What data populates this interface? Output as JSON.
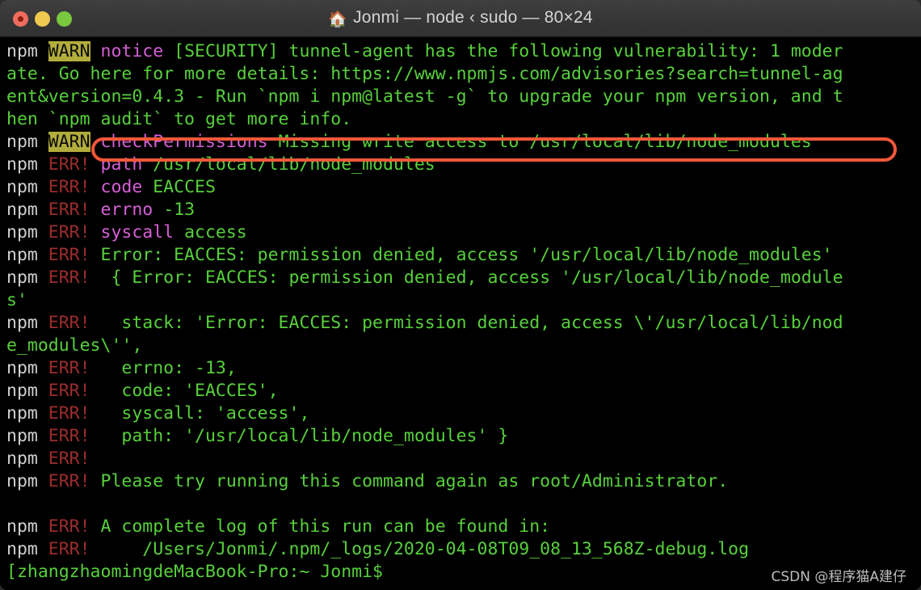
{
  "window": {
    "title": "Jonmi — node ‹ sudo — 80×24",
    "home_icon": "🏠",
    "cols": 80,
    "rows": 24,
    "controls": {
      "close_label": "",
      "minimize_label": "",
      "maximize_label": ""
    }
  },
  "colors": {
    "background": "#000000",
    "green": "#57d13b",
    "npm_white": "#d0d0d0",
    "err_red": "#9e2d2d",
    "warn_bg": "#b2ad3c",
    "warn_fg": "#0a0a0a",
    "magenta": "#d75fd7",
    "annotation": "#f4573a",
    "titlebar": "#363637"
  },
  "annotation": {
    "shape": "rounded-rectangle",
    "color": "#f4573a",
    "target_line_index": 4,
    "text": "checkPermissions Missing write access to /usr/local/lib/node_modules"
  },
  "watermark": {
    "text": "CSDN @程序猫A建仔"
  },
  "terminal": {
    "lines": [
      {
        "segs": [
          {
            "t": "npm ",
            "c": "c-npm"
          },
          {
            "t": "WARN",
            "c": "c-warn"
          },
          {
            "t": " ",
            "c": "c-green"
          },
          {
            "t": "notice",
            "c": "c-key"
          },
          {
            "t": " [SECURITY] tunnel-agent has the following vulnerability: 1 moder",
            "c": "c-green"
          }
        ]
      },
      {
        "segs": [
          {
            "t": "ate. Go here for more details: https://www.npmjs.com/advisories?search=tunnel-ag",
            "c": "c-green"
          }
        ]
      },
      {
        "segs": [
          {
            "t": "ent&version=0.4.3 - Run `npm i npm@latest -g` to upgrade your npm version, and t",
            "c": "c-green"
          }
        ]
      },
      {
        "segs": [
          {
            "t": "hen `npm audit` to get more info.",
            "c": "c-green"
          }
        ]
      },
      {
        "segs": [
          {
            "t": "npm ",
            "c": "c-npm"
          },
          {
            "t": "WARN",
            "c": "c-warn"
          },
          {
            "t": " ",
            "c": "c-green"
          },
          {
            "t": "checkPermissions",
            "c": "c-key"
          },
          {
            "t": " Missing write access to /usr/local/lib/node_modules",
            "c": "c-green"
          }
        ]
      },
      {
        "segs": [
          {
            "t": "npm ",
            "c": "c-npm"
          },
          {
            "t": "ERR!",
            "c": "c-err"
          },
          {
            "t": " ",
            "c": "c-green"
          },
          {
            "t": "path",
            "c": "c-key"
          },
          {
            "t": " /usr/local/lib/node_modules",
            "c": "c-green"
          }
        ]
      },
      {
        "segs": [
          {
            "t": "npm ",
            "c": "c-npm"
          },
          {
            "t": "ERR!",
            "c": "c-err"
          },
          {
            "t": " ",
            "c": "c-green"
          },
          {
            "t": "code",
            "c": "c-key"
          },
          {
            "t": " EACCES",
            "c": "c-green"
          }
        ]
      },
      {
        "segs": [
          {
            "t": "npm ",
            "c": "c-npm"
          },
          {
            "t": "ERR!",
            "c": "c-err"
          },
          {
            "t": " ",
            "c": "c-green"
          },
          {
            "t": "errno",
            "c": "c-key"
          },
          {
            "t": " -13",
            "c": "c-green"
          }
        ]
      },
      {
        "segs": [
          {
            "t": "npm ",
            "c": "c-npm"
          },
          {
            "t": "ERR!",
            "c": "c-err"
          },
          {
            "t": " ",
            "c": "c-green"
          },
          {
            "t": "syscall",
            "c": "c-key"
          },
          {
            "t": " access",
            "c": "c-green"
          }
        ]
      },
      {
        "segs": [
          {
            "t": "npm ",
            "c": "c-npm"
          },
          {
            "t": "ERR!",
            "c": "c-err"
          },
          {
            "t": " Error: EACCES: permission denied, access '/usr/local/lib/node_modules'",
            "c": "c-green"
          }
        ]
      },
      {
        "segs": [
          {
            "t": "npm ",
            "c": "c-npm"
          },
          {
            "t": "ERR!",
            "c": "c-err"
          },
          {
            "t": "  { Error: EACCES: permission denied, access '/usr/local/lib/node_module",
            "c": "c-green"
          }
        ]
      },
      {
        "segs": [
          {
            "t": "s'",
            "c": "c-green"
          }
        ]
      },
      {
        "segs": [
          {
            "t": "npm ",
            "c": "c-npm"
          },
          {
            "t": "ERR!",
            "c": "c-err"
          },
          {
            "t": "   stack: 'Error: EACCES: permission denied, access \\'/usr/local/lib/nod",
            "c": "c-green"
          }
        ]
      },
      {
        "segs": [
          {
            "t": "e_modules\\'',",
            "c": "c-green"
          }
        ]
      },
      {
        "segs": [
          {
            "t": "npm ",
            "c": "c-npm"
          },
          {
            "t": "ERR!",
            "c": "c-err"
          },
          {
            "t": "   errno: -13,",
            "c": "c-green"
          }
        ]
      },
      {
        "segs": [
          {
            "t": "npm ",
            "c": "c-npm"
          },
          {
            "t": "ERR!",
            "c": "c-err"
          },
          {
            "t": "   code: 'EACCES',",
            "c": "c-green"
          }
        ]
      },
      {
        "segs": [
          {
            "t": "npm ",
            "c": "c-npm"
          },
          {
            "t": "ERR!",
            "c": "c-err"
          },
          {
            "t": "   syscall: 'access',",
            "c": "c-green"
          }
        ]
      },
      {
        "segs": [
          {
            "t": "npm ",
            "c": "c-npm"
          },
          {
            "t": "ERR!",
            "c": "c-err"
          },
          {
            "t": "   path: '/usr/local/lib/node_modules' }",
            "c": "c-green"
          }
        ]
      },
      {
        "segs": [
          {
            "t": "npm ",
            "c": "c-npm"
          },
          {
            "t": "ERR!",
            "c": "c-err"
          }
        ]
      },
      {
        "segs": [
          {
            "t": "npm ",
            "c": "c-npm"
          },
          {
            "t": "ERR!",
            "c": "c-err"
          },
          {
            "t": " Please try running this command again as root/Administrator.",
            "c": "c-green"
          }
        ]
      },
      {
        "segs": [
          {
            "t": " ",
            "c": "c-green"
          }
        ]
      },
      {
        "segs": [
          {
            "t": "npm ",
            "c": "c-npm"
          },
          {
            "t": "ERR!",
            "c": "c-err"
          },
          {
            "t": " A complete log of this run can be found in:",
            "c": "c-green"
          }
        ]
      },
      {
        "segs": [
          {
            "t": "npm ",
            "c": "c-npm"
          },
          {
            "t": "ERR!",
            "c": "c-err"
          },
          {
            "t": "     /Users/Jonmi/.npm/_logs/2020-04-08T09_08_13_568Z-debug.log",
            "c": "c-green"
          }
        ]
      },
      {
        "segs": [
          {
            "t": "[zhangzhaomingdeMacBook-Pro:~ Jonmi$",
            "c": "c-green"
          }
        ]
      }
    ]
  }
}
